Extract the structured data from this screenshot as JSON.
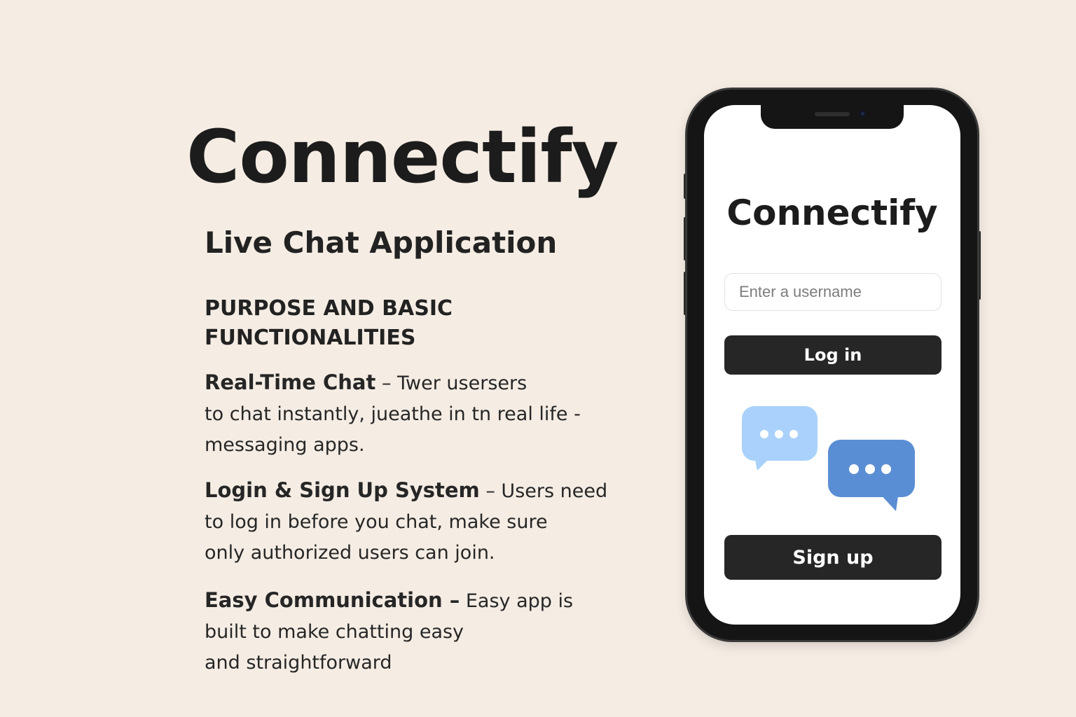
{
  "hero": {
    "title": "Connectify",
    "subtitle": "Live Chat Application"
  },
  "section": {
    "heading_line1": "PURPOSE AND BASIC",
    "heading_line2": "FUNCTIONALITIES"
  },
  "features": [
    {
      "title": "Real-Time Chat",
      "line1_rest": " – Twer usersers",
      "line2": "to chat instantly, jueathe in tn real life -",
      "line3": "messaging apps."
    },
    {
      "title": "Login & Sign Up System",
      "line1_rest": " – Users need",
      "line2": "to log in before you chat, make sure",
      "line3": "only authorized users can join."
    },
    {
      "title": "Easy Communication –",
      "line1_rest": " Easy app is",
      "line2": "built to make chatting easy",
      "line3": "and straightforward"
    }
  ],
  "phone": {
    "app_title": "Connectify",
    "username_placeholder": "Enter a username",
    "login_label": "Log in",
    "signup_label": "Sign up",
    "illustration": {
      "bubble_light_color": "#a9d1fb",
      "bubble_dark_color": "#5a8ed4",
      "dot_color": "#ffffff",
      "icon_names": [
        "chat-bubble-icon",
        "chat-bubble-icon"
      ]
    }
  },
  "colors": {
    "background": "#f5ede4",
    "text": "#1f1f1f",
    "button": "#262626",
    "phone_frame": "#151515"
  }
}
